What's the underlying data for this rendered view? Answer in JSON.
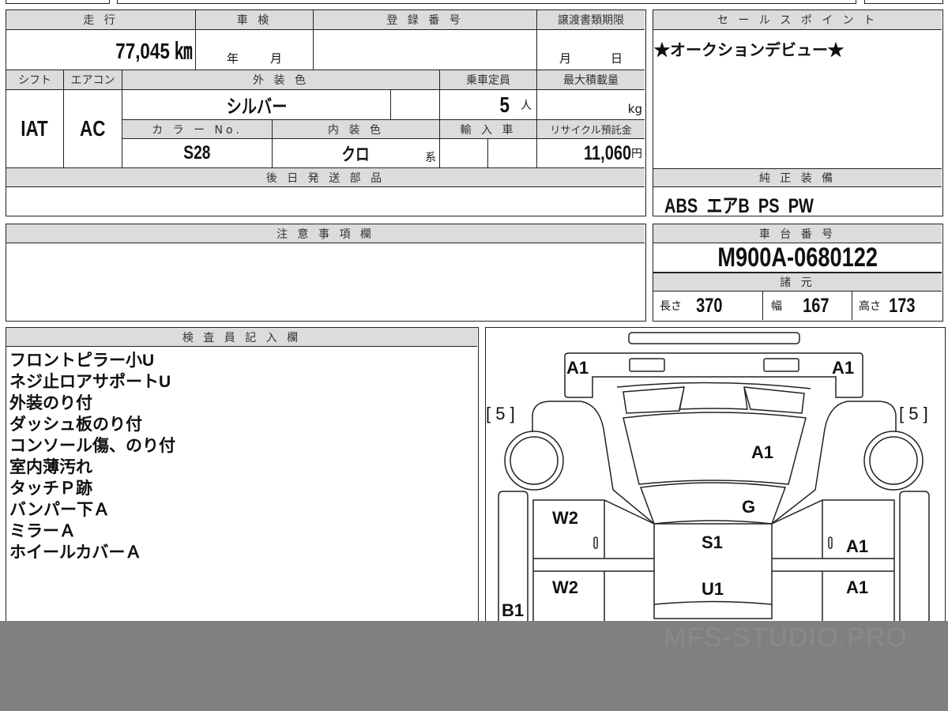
{
  "vehicle": {
    "mileage_label": "走 行",
    "mileage_value": "77,045 ㎞",
    "inspection_label": "車 検",
    "inspection_year_unit": "年",
    "inspection_month_unit": "月",
    "registration_label": "登 録 番 号",
    "transfer_deadline_label": "譲渡書類期限",
    "transfer_month_unit": "月",
    "transfer_day_unit": "日",
    "shift_label": "シフト",
    "shift_value": "IAT",
    "aircon_label": "エアコン",
    "aircon_value": "AC",
    "exterior_color_label": "外 装 色",
    "exterior_color_value": "シルバー",
    "capacity_label": "乗車定員",
    "capacity_value": "5",
    "capacity_unit": "人",
    "max_load_label": "最大積載量",
    "max_load_unit": "kg",
    "color_no_label": "カ ラ ー No.",
    "color_no_value": "S28",
    "interior_color_label": "内 装 色",
    "interior_color_value": "クロ",
    "interior_color_suffix": "系",
    "import_label": "輸 入 車",
    "recycle_label": "リサイクル預託金",
    "recycle_value": "11,060",
    "recycle_unit": "円",
    "later_parts_label": "後 日 発 送 部 品"
  },
  "sales_point": {
    "label": "セ ー ル ス ポ イ ン ト",
    "value": "★オークションデビュー★"
  },
  "equipment": {
    "label": "純 正 装 備",
    "value": "ABS  エアB  PS  PW"
  },
  "notes": {
    "label": "注 意 事 項 欄"
  },
  "chassis": {
    "label": "車 台 番 号",
    "value": "M900A-0680122",
    "specs_label": "諸 元",
    "length_label": "長さ",
    "length_value": "370",
    "width_label": "幅",
    "width_value": "167",
    "height_label": "高さ",
    "height_value": "173"
  },
  "inspector": {
    "label": "検 査 員 記 入 欄",
    "lines": [
      "フロントピラー小U",
      "ネジ止ロアサポートU",
      "外装のり付",
      "ダッシュ板のり付",
      "コンソール傷、のり付",
      "室内薄汚れ",
      "タッチＰ跡",
      "バンパー下Ａ",
      "ミラーＡ",
      "ホイールカバーＡ"
    ]
  },
  "diagram": {
    "marks": {
      "front_left": "A1",
      "front_right": "A1",
      "tire_left": "[ 5 ]",
      "tire_right": "[ 5 ]",
      "hood": "A1",
      "windshield": "G",
      "left_front_door": "W2",
      "left_front_small": "0",
      "roof": "S1",
      "right_front_small": "0",
      "right_front_door": "A1",
      "left_rear_door": "W2",
      "center_rear": "U1",
      "right_rear_door": "A1",
      "left_side": "B1"
    }
  },
  "watermark": "MFS-STUDIO.PRO"
}
